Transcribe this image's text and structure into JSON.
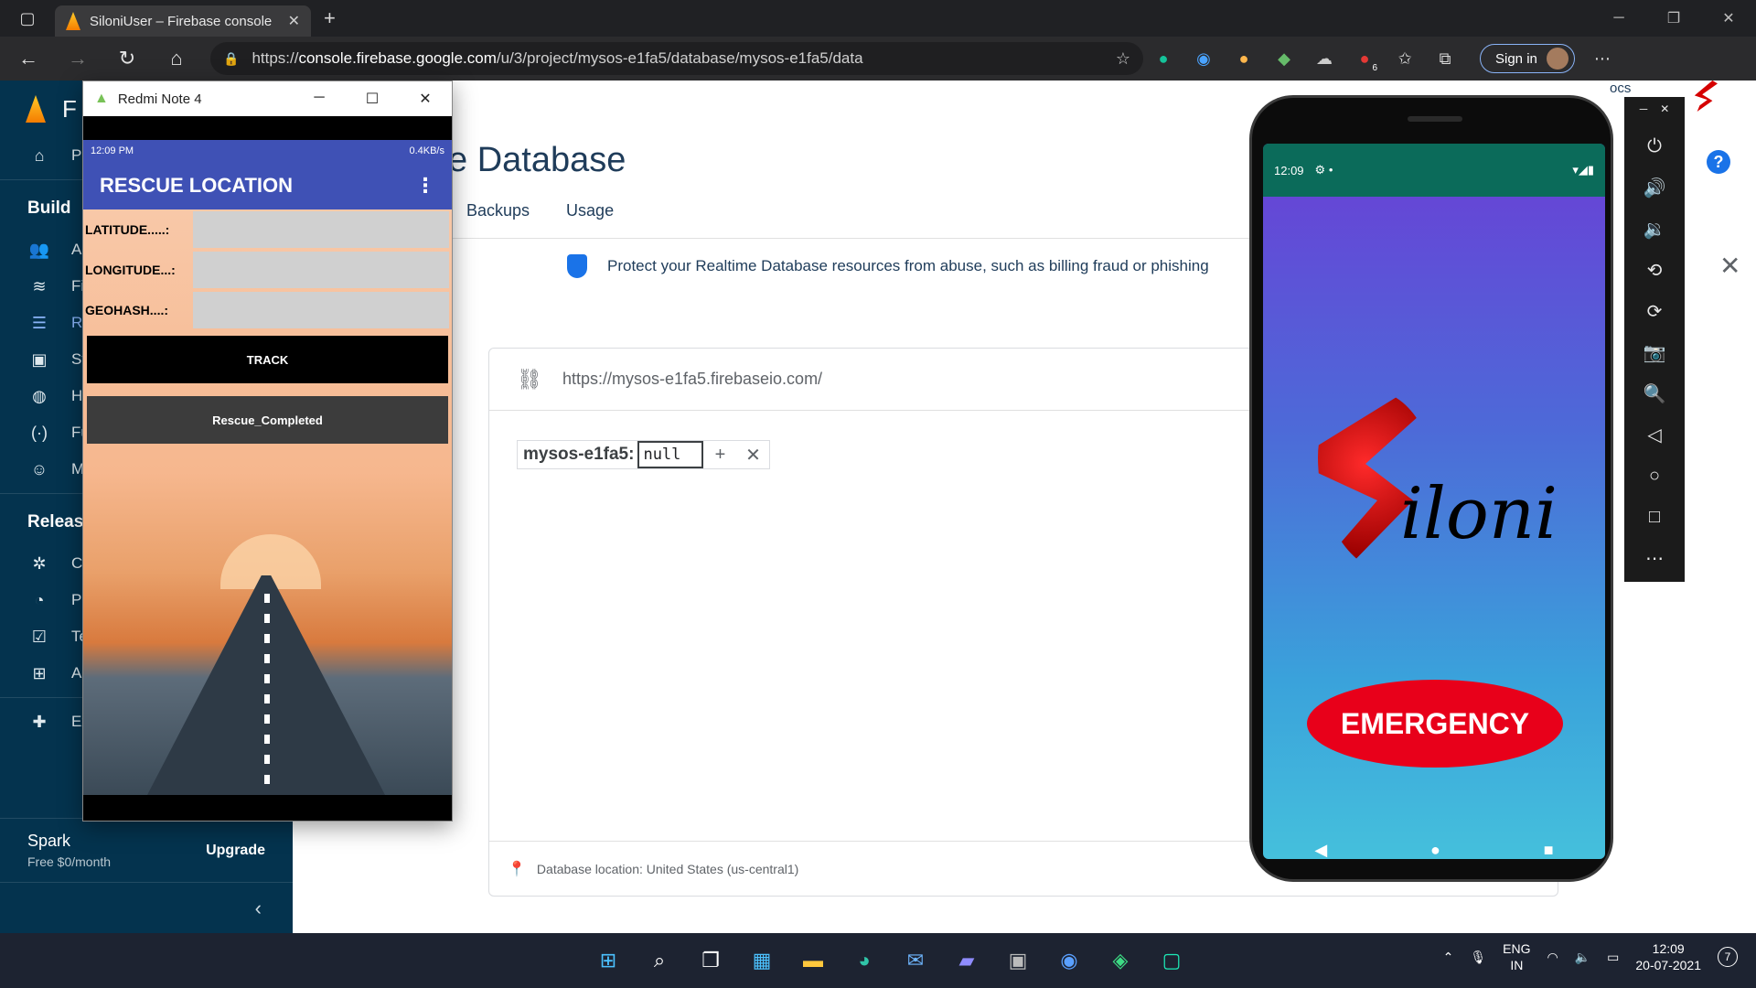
{
  "browser": {
    "tab_title": "SiloniUser – Firebase console",
    "url_prefix": "https://",
    "url_host": "console.firebase.google.com",
    "url_path": "/u/3/project/mysos-e1fa5/database/mysos-e1fa5/data",
    "sign_in_label": "Sign in",
    "extension_badge": "6"
  },
  "sidebar": {
    "brand_partial": "F",
    "items": [
      {
        "label": "Pr",
        "icon": "home-icon"
      },
      {
        "label": "Build",
        "section": true
      },
      {
        "label": "Au",
        "icon": "people-icon"
      },
      {
        "label": "Fi",
        "icon": "firestore-icon"
      },
      {
        "label": "Re",
        "icon": "realtime-db-icon",
        "active": true
      },
      {
        "label": "St",
        "icon": "storage-icon"
      },
      {
        "label": "Ho",
        "icon": "hosting-icon"
      },
      {
        "label": "Fu",
        "icon": "functions-icon"
      },
      {
        "label": "M",
        "icon": "ml-icon"
      },
      {
        "label": "Releas",
        "section": true
      },
      {
        "label": "Cr",
        "icon": "crashlytics-icon"
      },
      {
        "label": "Pe",
        "icon": "performance-icon"
      },
      {
        "label": "Te",
        "icon": "test-lab-icon"
      },
      {
        "label": "Ap",
        "icon": "app-distribution-icon"
      },
      {
        "label": "Ex",
        "icon": "extensions-icon"
      }
    ],
    "plan_name": "Spark",
    "plan_price": "Free $0/month",
    "upgrade_label": "Upgrade"
  },
  "main": {
    "title_partial": "e Database",
    "tabs": [
      "Backups",
      "Usage"
    ],
    "banner": "Protect your Realtime Database resources from abuse, such as billing fraud or phishing",
    "db_url": "https://mysos-e1fa5.firebaseio.com/",
    "node_key": "mysos-e1fa5:",
    "node_value": "null",
    "db_location": "Database location: United States (us-central1)",
    "docs_partial": "ocs"
  },
  "redmi": {
    "window_title": "Redmi Note 4",
    "status_time": "12:09 PM",
    "status_right": "0.4KB/s",
    "app_title": "RESCUE LOCATION",
    "fields": [
      {
        "label": "LATITUDE.....:"
      },
      {
        "label": "LONGITUDE...:"
      },
      {
        "label": "GEOHASH....:"
      }
    ],
    "track_label": "TRACK",
    "rescue_label": "Rescue_Completed"
  },
  "phone": {
    "status_time": "12:09",
    "logo_text": "iloni",
    "emergency_label": "EMERGENCY"
  },
  "taskbar": {
    "lang_top": "ENG",
    "lang_bottom": "IN",
    "time": "12:09",
    "date": "20-07-2021",
    "notif_count": "7"
  }
}
